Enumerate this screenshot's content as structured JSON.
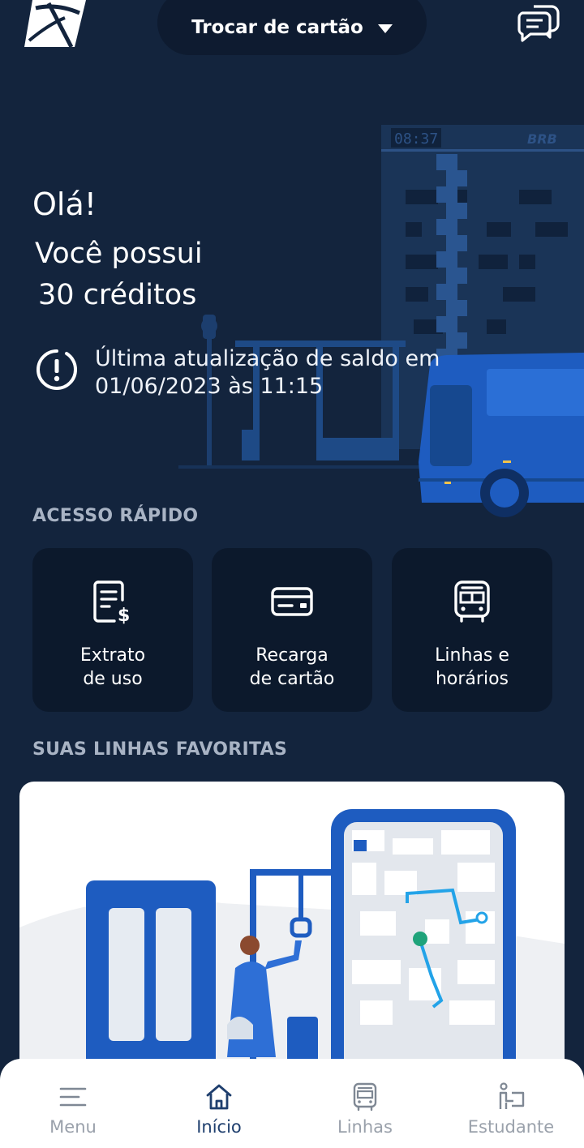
{
  "header": {
    "card_switch_label": "Trocar de cartão"
  },
  "hero": {
    "building_clock": "08:37",
    "building_brand": "BRB"
  },
  "greeting": {
    "hello": "Olá!",
    "credits_line1": "Você possui",
    "credits_line2": "30 créditos",
    "update_line1": "Última atualização de saldo em",
    "update_line2": "01/06/2023 às 11:15"
  },
  "quick_access": {
    "title": "ACESSO RÁPIDO",
    "items": [
      {
        "line1": "Extrato",
        "line2": "de uso",
        "icon": "receipt-dollar-icon"
      },
      {
        "line1": "Recarga",
        "line2": "de cartão",
        "icon": "card-icon"
      },
      {
        "line1": "Linhas e",
        "line2": "horários",
        "icon": "bus-icon"
      }
    ]
  },
  "favorites": {
    "title": "SUAS LINHAS FAVORITAS"
  },
  "bottom_nav": {
    "active_color": "#1f3f6e",
    "inactive_color": "#9aa1ab",
    "items": [
      {
        "label": "Menu",
        "icon": "menu-icon",
        "active": false
      },
      {
        "label": "Início",
        "icon": "home-icon",
        "active": true
      },
      {
        "label": "Linhas",
        "icon": "bus-icon",
        "active": false
      },
      {
        "label": "Estudante",
        "icon": "student-icon",
        "active": false
      }
    ]
  },
  "colors": {
    "background": "#13243d",
    "tile": "#0c192c",
    "accent_blue": "#1e5cc0"
  }
}
